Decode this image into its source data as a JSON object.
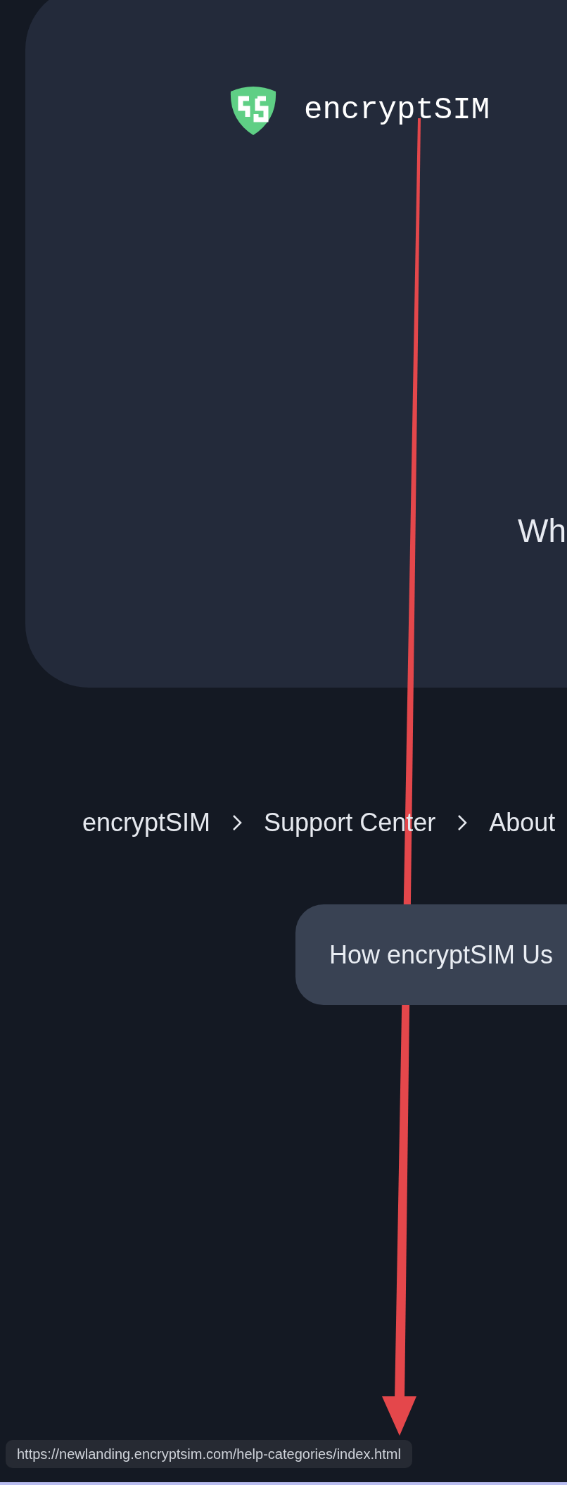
{
  "header": {
    "brand": "encryptSIM"
  },
  "hero": {
    "heading": "Wh"
  },
  "breadcrumb": [
    {
      "label": "encryptSIM"
    },
    {
      "label": "Support Center"
    },
    {
      "label": "About"
    }
  ],
  "category_button": {
    "label": "How encryptSIM Us"
  },
  "status_bar": {
    "url": "https://newlanding.encryptsim.com/help-categories/index.html"
  },
  "annotation": {
    "kind": "arrow"
  }
}
